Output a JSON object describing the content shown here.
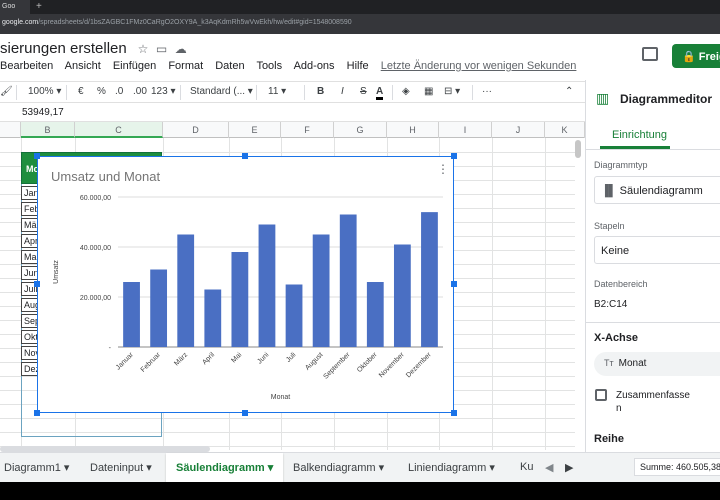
{
  "browser": {
    "tab_label": "Goo",
    "url_host": "google.com",
    "url_rest": "/spreadsheets/d/1bsZAGBC1FMz0CaRgO2OXY9A_k3AqKdmRh5wVwEkh/hw/edit#gid=1548008590"
  },
  "doc": {
    "title": "sierungen erstellen"
  },
  "menu": [
    "Bearbeiten",
    "Ansicht",
    "Einfügen",
    "Format",
    "Daten",
    "Tools",
    "Add-ons",
    "Hilfe"
  ],
  "last_change": "Letzte Änderung vor wenigen Sekunden",
  "share_label": "Freige",
  "toolbar": {
    "zoom": "100%",
    "euro": "€",
    "pct": "%",
    "dec_less": ".0",
    "dec_more": ".00",
    "numfmt": "123",
    "font": "Standard (...",
    "size": "11",
    "bold": "B",
    "italic": "I",
    "strike": "S",
    "textcolor": "A"
  },
  "formula_value": "53949,17",
  "columns": [
    "B",
    "C",
    "D",
    "E",
    "F",
    "G",
    "H",
    "I",
    "J",
    "K"
  ],
  "table": {
    "header": "Mo",
    "months_short": [
      "Jan",
      "Feb",
      "Mä",
      "Apr",
      "Ma",
      "Jun",
      "Juli",
      "Aug",
      "Sep",
      "Okt",
      "Nov",
      "Dez"
    ]
  },
  "chart_data": {
    "type": "bar",
    "title": "Umsatz und Monat",
    "xlabel": "Monat",
    "ylabel": "Umsatz",
    "categories": [
      "Januar",
      "Februar",
      "März",
      "April",
      "Mai",
      "Juni",
      "Juli",
      "August",
      "September",
      "Oktober",
      "November",
      "Dezember"
    ],
    "values": [
      26000,
      31000,
      45000,
      23000,
      38000,
      49000,
      25000,
      45000,
      53000,
      26000,
      41000,
      53949.17
    ],
    "ylim": [
      0,
      60000
    ],
    "yticks": [
      "-",
      "20.000,00",
      "40.000,00",
      "60.000,00"
    ],
    "bar_color": "#4a6fc3",
    "grid": true
  },
  "sheet_tabs": [
    "Diagramm1",
    "Dateninput",
    "Säulendiagramm",
    "Balkendiagramm",
    "Liniendiagramm",
    "Ku"
  ],
  "sum": "Summe: 460.505,38",
  "panel": {
    "title": "Diagrammeditor",
    "tab": "Einrichtung",
    "type_label": "Diagrammtyp",
    "type_value": "Säulendiagramm",
    "stack_label": "Stapeln",
    "stack_value": "Keine",
    "range_label": "Datenbereich",
    "range_value": "B2:C14",
    "xaxis_label": "X-Achse",
    "xaxis_value": "Monat",
    "aggregate_label": "Zusammenfasse",
    "aggregate_label2": "n",
    "series_label": "Reihe"
  }
}
